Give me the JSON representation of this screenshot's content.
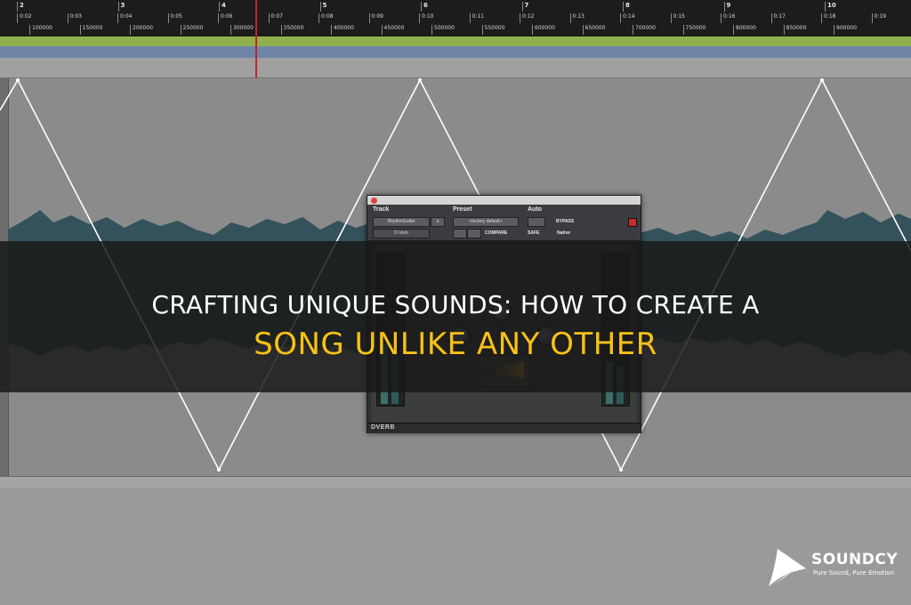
{
  "ruler": {
    "bars": [
      "2",
      "3",
      "4",
      "5",
      "6",
      "7",
      "8",
      "9",
      "10"
    ],
    "minutes": [
      "0:02",
      "0:03",
      "0:04",
      "0:05",
      "0:06",
      "0:07",
      "0:08",
      "0:09",
      "0:10",
      "0:11",
      "0:12",
      "0:13",
      "0:14",
      "0:15",
      "0:16",
      "0:17",
      "0:18",
      "0:19"
    ],
    "samples": [
      "100000",
      "150000",
      "200000",
      "250000",
      "300000",
      "350000",
      "400000",
      "450000",
      "500000",
      "550000",
      "600000",
      "650000",
      "700000",
      "750000",
      "800000",
      "850000",
      "900000"
    ]
  },
  "plugin": {
    "track_label": "Track",
    "preset_label": "Preset",
    "auto_label": "Auto",
    "track_name": "RhythmGuitar",
    "track_suffix": "a",
    "preset_name": "<factory default>",
    "insert_name": "D-Verb",
    "compare_label": "COMPARE",
    "bypass_label": "BYPASS",
    "safe_label": "SAFE",
    "native_label": "Native",
    "brand": "DVERB"
  },
  "headline": {
    "line1": "CRAFTING UNIQUE SOUNDS: HOW TO CREATE A",
    "line2": "SONG UNLIKE ANY OTHER"
  },
  "logo": {
    "name": "SOUNDCY",
    "tagline": "Pure Sound, Pure Emotion"
  }
}
